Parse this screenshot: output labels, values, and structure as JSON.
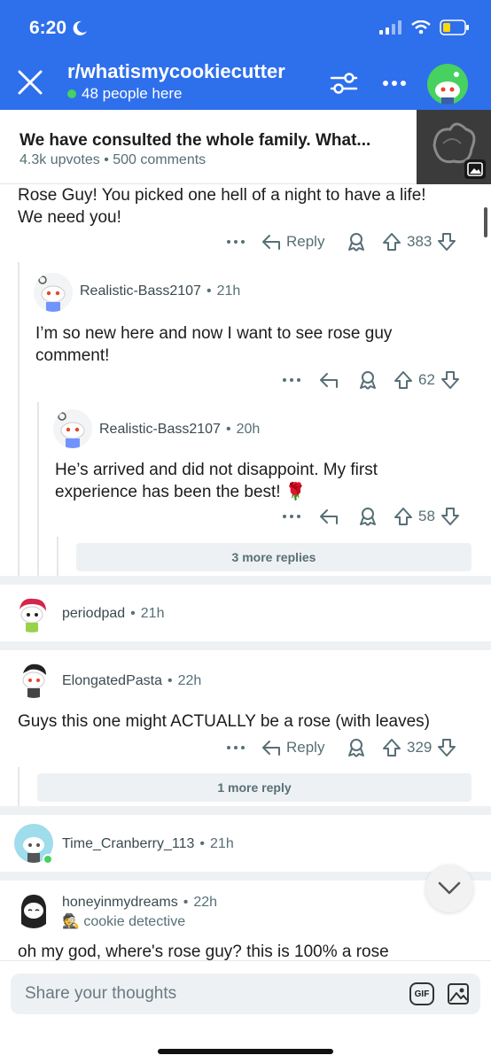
{
  "status": {
    "time": "6:20"
  },
  "header": {
    "subreddit": "r/whatismycookiecutter",
    "online": "48 people here"
  },
  "post": {
    "title": "We have consulted the whole family. What...",
    "upvotes": "4.3k upvotes",
    "comments": "500 comments"
  },
  "comments": [
    {
      "body_l1": "Rose Guy! You picked one hell of a night to have a life!",
      "body_l2": "We need you!",
      "reply": "Reply",
      "votes": "383"
    },
    {
      "author": "Realistic-Bass2107",
      "age": "21h",
      "body_l1": "I’m so new here and now I want to see rose guy",
      "body_l2": "comment!",
      "votes": "62"
    },
    {
      "author": "Realistic-Bass2107",
      "age": "20h",
      "body_l1": "He’s arrived and did not disappoint. My first",
      "body_l2": "experience has been the best! 🌹",
      "votes": "58",
      "more": "3 more replies"
    },
    {
      "author": "periodpad",
      "age": "21h"
    },
    {
      "author": "ElongatedPasta",
      "age": "22h",
      "body": "Guys this one might ACTUALLY be a rose (with leaves)",
      "reply": "Reply",
      "votes": "329",
      "more": "1 more reply"
    },
    {
      "author": "Time_Cranberry_113",
      "age": "21h"
    },
    {
      "author": "honeyinmydreams",
      "age": "22h",
      "flair": "🕵️ cookie detective",
      "body": "oh my god, where's rose guy? this is 100% a rose"
    }
  ],
  "composer": {
    "placeholder": "Share your thoughts",
    "gif_label": "GIF"
  },
  "colors": {
    "header": "#2e6fec",
    "online": "#46d160",
    "meta": "#576f76"
  }
}
